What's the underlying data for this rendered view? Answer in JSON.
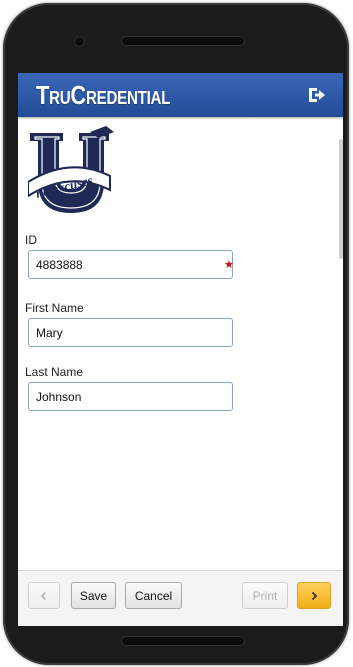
{
  "app": {
    "title": "TruCredential"
  },
  "header": {
    "logout_icon": "logout-icon"
  },
  "logo": {
    "text": "no excuses",
    "letter": "U",
    "colors": {
      "navy": "#1e2a55",
      "white": "#ffffff"
    }
  },
  "form": {
    "id": {
      "label": "ID",
      "value": "4883888",
      "required": true
    },
    "first_name": {
      "label": "First Name",
      "value": "Mary"
    },
    "last_name": {
      "label": "Last Name",
      "value": "Johnson"
    }
  },
  "footer": {
    "prev_icon": "chevron-left-icon",
    "save_label": "Save",
    "cancel_label": "Cancel",
    "print_label": "Print",
    "next_icon": "chevron-right-icon"
  },
  "colors": {
    "header_blue": "#2f5aa8",
    "next_button": "#f5b324",
    "required_star": "#dd0000"
  }
}
